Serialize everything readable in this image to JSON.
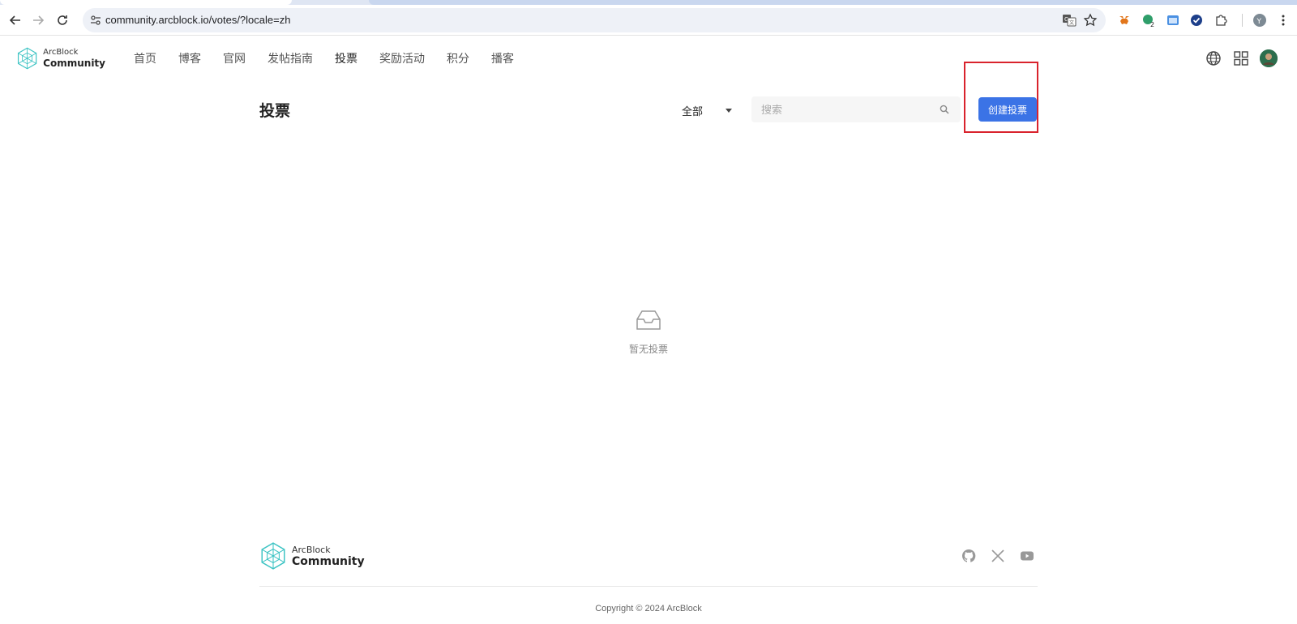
{
  "browser": {
    "url": "community.arcblock.io/votes/?locale=zh",
    "profile_initial": "Y",
    "extension_badge": "2"
  },
  "header": {
    "logo_small": "ArcBlock",
    "logo_big": "Community",
    "nav": [
      {
        "label": "首页"
      },
      {
        "label": "博客"
      },
      {
        "label": "官网"
      },
      {
        "label": "发帖指南"
      },
      {
        "label": "投票"
      },
      {
        "label": "奖励活动"
      },
      {
        "label": "积分"
      },
      {
        "label": "播客"
      }
    ],
    "active_nav": "投票"
  },
  "main": {
    "title": "投票",
    "filter_value": "全部",
    "search_placeholder": "搜索",
    "create_button": "创建投票",
    "empty_text": "暂无投票"
  },
  "footer": {
    "logo_small": "ArcBlock",
    "logo_big": "Community",
    "copyright": "Copyright © 2024 ArcBlock",
    "socials": [
      "github-icon",
      "x-icon",
      "youtube-icon"
    ]
  },
  "colors": {
    "primary": "#3b73e6",
    "highlight": "#d9232d"
  }
}
